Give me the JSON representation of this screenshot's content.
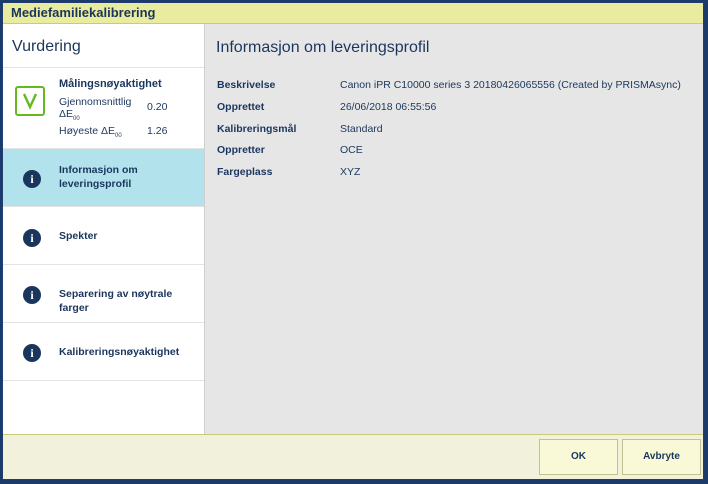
{
  "window": {
    "title": "Mediefamiliekalibrering"
  },
  "sidebar": {
    "title": "Vurdering",
    "summary": {
      "title": "Målingsnøyaktighet",
      "avg_label_line1": "Gjennomsnittlig",
      "avg_label_line2": "ΔE",
      "avg_sub": "00",
      "avg_value": "0.20",
      "max_label": "Høyeste ΔE",
      "max_sub": "00",
      "max_value": "1.26"
    },
    "items": [
      {
        "label_line1": "Informasjon om",
        "label_line2": "leveringsprofil",
        "icon": "info-icon",
        "active": true
      },
      {
        "label": "Spekter",
        "icon": "info-icon"
      },
      {
        "label": "Separering av nøytrale farger",
        "icon": "info-icon"
      },
      {
        "label": "Kalibreringsnøyaktighet",
        "icon": "info-icon"
      }
    ]
  },
  "main": {
    "title": "Informasjon om leveringsprofil",
    "rows": [
      {
        "label": "Beskrivelse",
        "value": "Canon iPR C10000 series 3 20180426065556 (Created by PRISMAsync)"
      },
      {
        "label": "Opprettet",
        "value": "26/06/2018 06:55:56"
      },
      {
        "label": "Kalibreringsmål",
        "value": "Standard"
      },
      {
        "label": "Oppretter",
        "value": "OCE"
      },
      {
        "label": "Fargeplass",
        "value": "XYZ"
      }
    ]
  },
  "footer": {
    "ok_label": "OK",
    "cancel_label": "Avbryte"
  },
  "colors": {
    "title_bar": "#e9eb9e",
    "accent_text": "#1b365d",
    "active_item": "#b2e3ec",
    "check_green": "#66b820"
  }
}
